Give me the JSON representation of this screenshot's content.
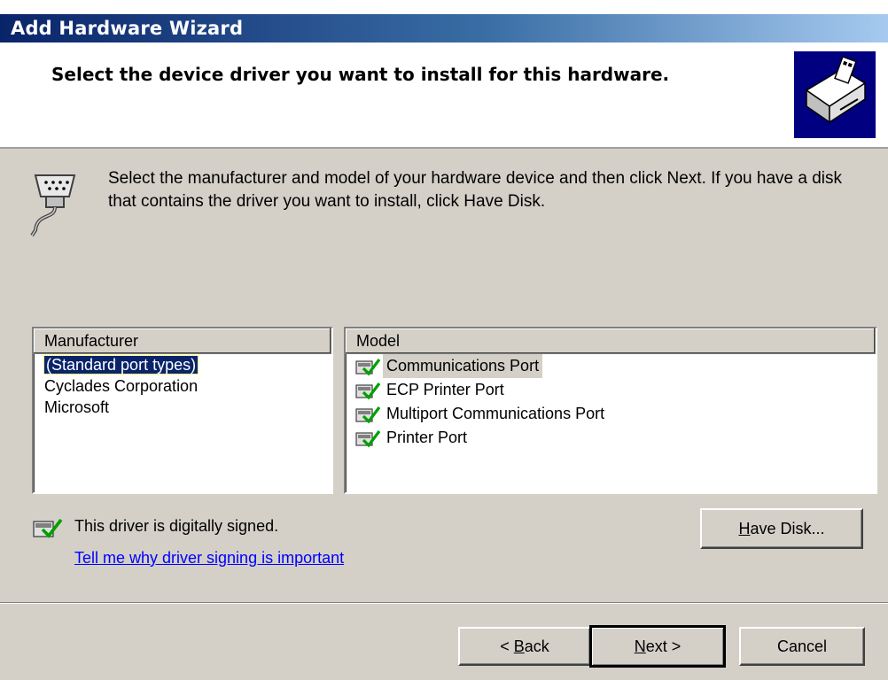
{
  "window": {
    "title": "Add Hardware Wizard"
  },
  "header": {
    "title": "Select the device driver you want to install for this hardware.",
    "icon": "hardware-wizard-icon"
  },
  "intro": {
    "icon": "serial-port-cable-icon",
    "text": "Select the manufacturer and model of your hardware device and then click Next. If you have a disk that contains the driver you want to install, click Have Disk."
  },
  "manufacturer": {
    "header": "Manufacturer",
    "items": [
      "(Standard port types)",
      "Cyclades Corporation",
      "Microsoft"
    ],
    "selected": "(Standard port types)"
  },
  "model": {
    "header": "Model",
    "items": [
      "Communications Port",
      "ECP Printer Port",
      "Multiport Communications Port",
      "Printer Port"
    ],
    "selected": "Communications Port",
    "item_icon": "signed-driver-icon"
  },
  "signing": {
    "status": "This driver is digitally signed.",
    "link": "Tell me why driver signing is important",
    "icon": "signed-driver-icon"
  },
  "buttons": {
    "have_disk": {
      "accel": "H",
      "rest": "ave Disk..."
    },
    "back": {
      "prefix": "< ",
      "accel": "B",
      "rest": "ack"
    },
    "next": {
      "accel": "N",
      "rest": "ext >"
    },
    "cancel": "Cancel"
  },
  "colors": {
    "title_start": "#0a246a",
    "title_end": "#a6caf0",
    "face": "#d4d0c8",
    "link": "#0000ff"
  }
}
